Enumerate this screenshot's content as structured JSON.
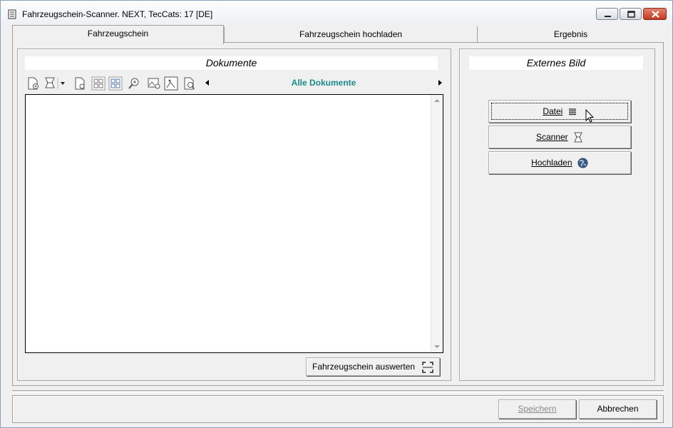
{
  "window": {
    "title": "Fahrzeugschein-Scanner. NEXT, TecCats: 17 [DE]"
  },
  "tabs": [
    {
      "label": "Fahrzeugschein"
    },
    {
      "label": "Fahrzeugschein hochladen"
    },
    {
      "label": "Ergebnis"
    }
  ],
  "documents": {
    "title": "Dokumente",
    "nav_label": "Alle Dokumente",
    "evaluate_button": "Fahrzeugschein auswerten"
  },
  "external": {
    "title": "Externes Bild",
    "datei_label": "Datei",
    "scanner_label": "Scanner",
    "upload_label": "Hochladen"
  },
  "footer": {
    "save_label": "Speichern",
    "cancel_label": "Abbrechen"
  },
  "colors": {
    "accent_teal": "#1a8a8a",
    "close_red": "#c43a22"
  }
}
